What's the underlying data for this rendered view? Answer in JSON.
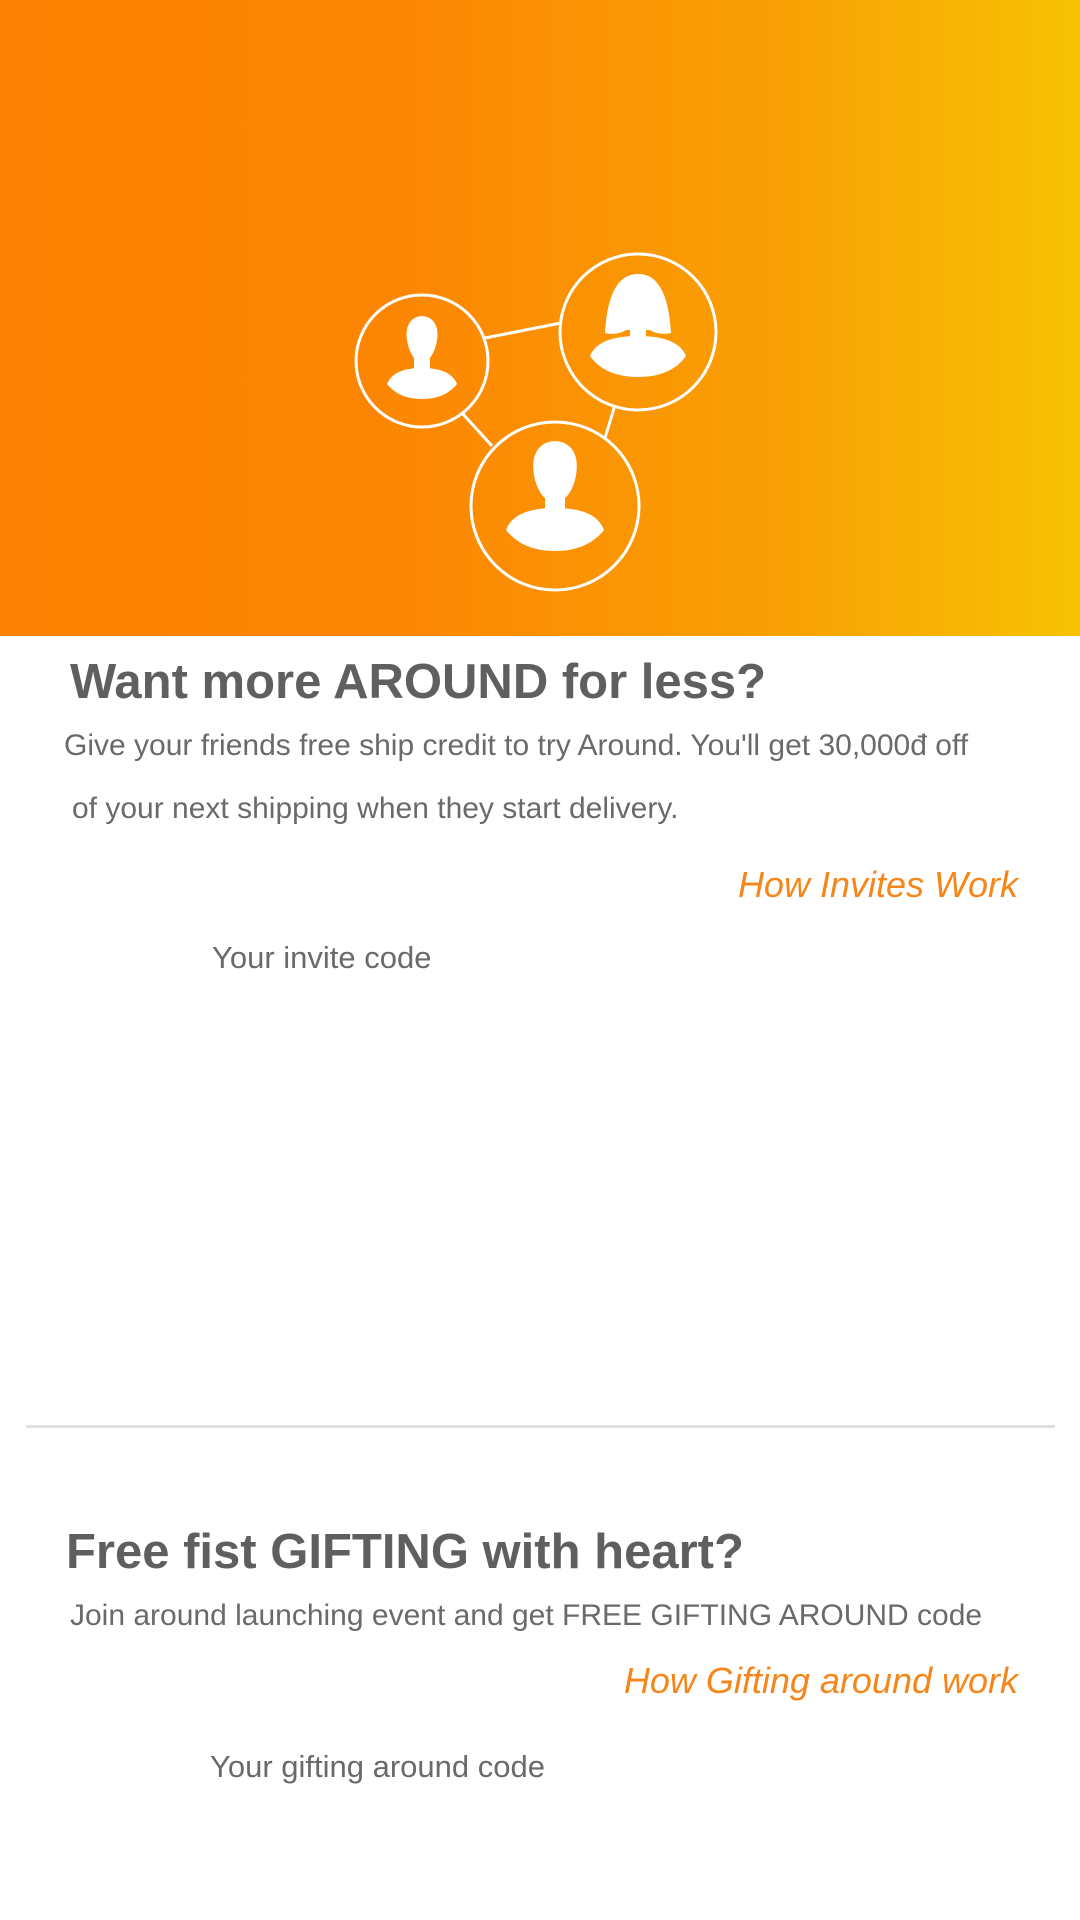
{
  "hero": {
    "illustration": "people-network-icon",
    "gradient_start": "#fd8102",
    "gradient_end": "#f7c204"
  },
  "invite": {
    "title": "Want more AROUND for less?",
    "description_line1": "Give your friends free ship credit to try Around. You'll get 30,000đ off",
    "description_line2": "of your next shipping when they start delivery.",
    "how_link": "How Invites Work",
    "code_label": "Your invite code"
  },
  "gifting": {
    "title": "Free fist GIFTING with heart?",
    "description": "Join around launching event and get FREE GIFTING AROUND code",
    "how_link": "How Gifting around work",
    "code_label": "Your gifting around code"
  },
  "colors": {
    "accent": "#f6861a",
    "heading": "#5f5f5f",
    "body_text": "#6a6a6a",
    "divider": "#e0e0e0"
  }
}
